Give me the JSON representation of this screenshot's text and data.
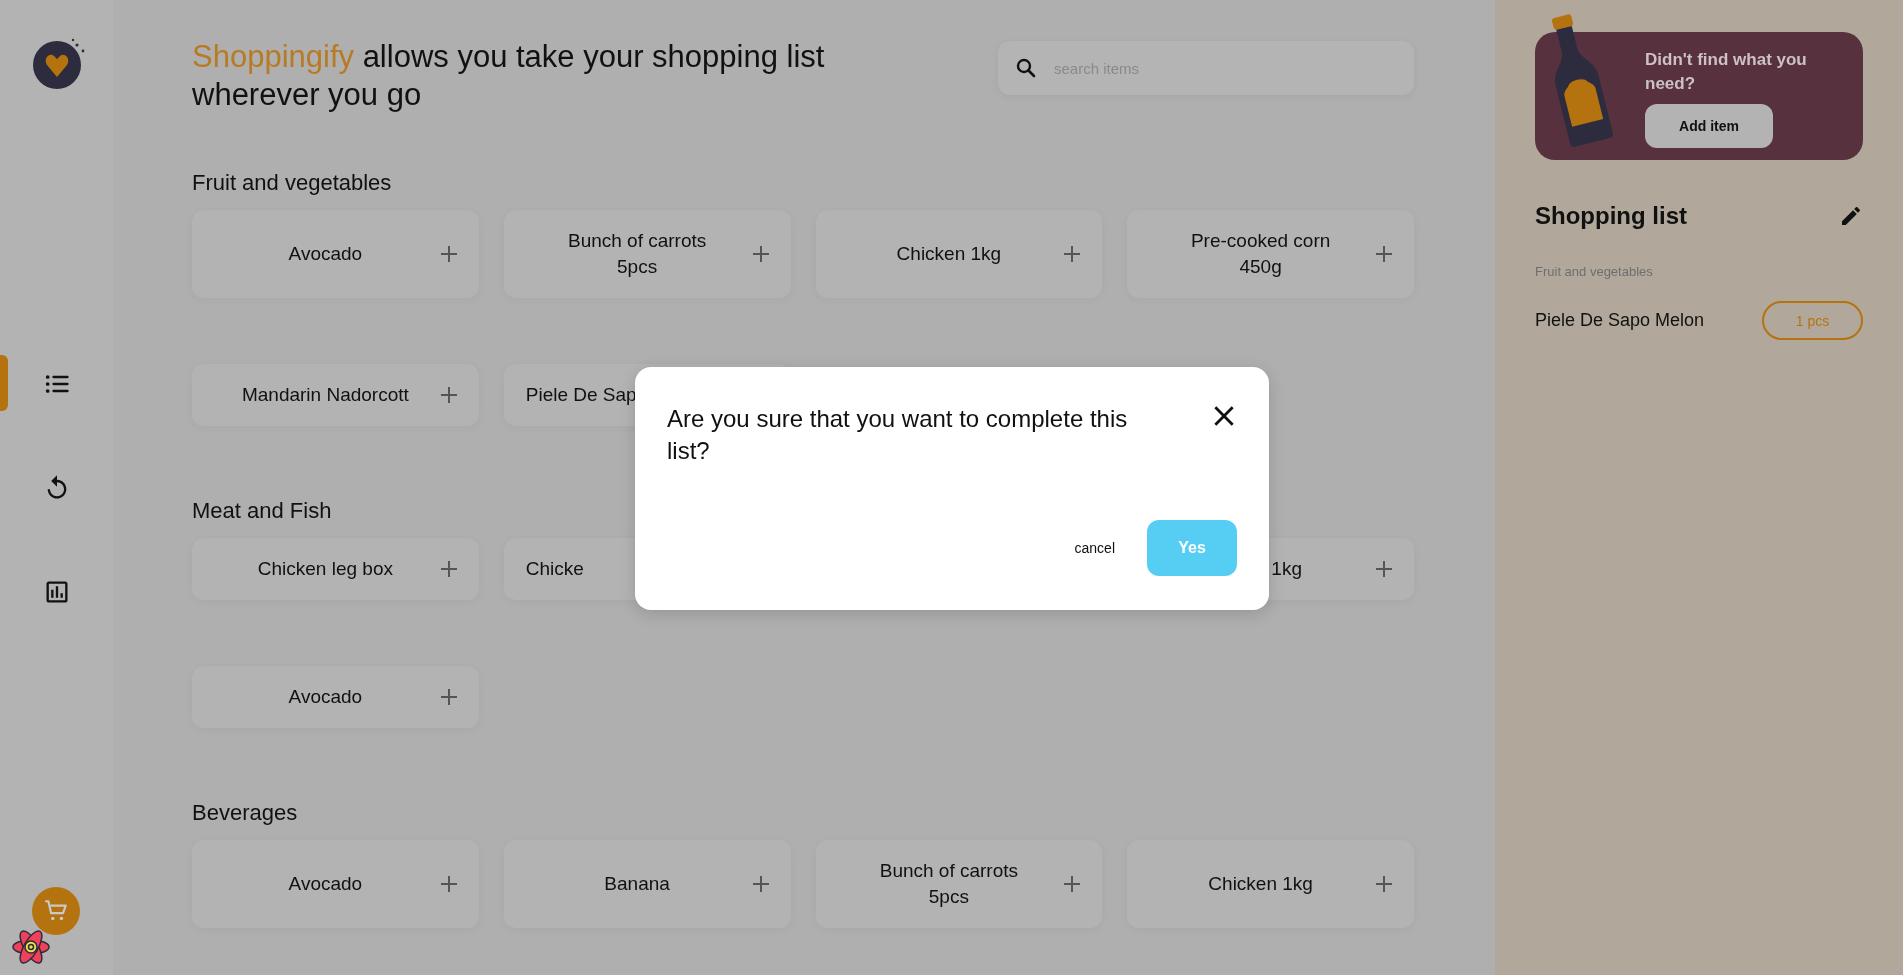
{
  "sidebar": {
    "nav": [
      {
        "kind": "list",
        "selected": true
      },
      {
        "kind": "history",
        "selected": false
      },
      {
        "kind": "stats",
        "selected": false
      }
    ]
  },
  "header": {
    "brand": "Shoppingify",
    "tagline": "allows you take your shopping list wherever you go"
  },
  "search": {
    "placeholder": "search items"
  },
  "categories": [
    {
      "name": "Fruit and vegetables",
      "items": [
        {
          "kind": "card",
          "label": "Avocado"
        },
        {
          "kind": "card",
          "label": "Bunch of carrots 5pcs"
        },
        {
          "kind": "card",
          "label": "Chicken 1kg"
        },
        {
          "kind": "card",
          "label": "Pre-cooked corn 450g"
        },
        {
          "kind": "card",
          "label": "Mandarin Nadorcott"
        },
        {
          "kind": "leftpart",
          "label": "Piele De Sap"
        }
      ]
    },
    {
      "name": "Meat and Fish",
      "items": [
        {
          "kind": "card",
          "label": "Chicken leg box"
        },
        {
          "kind": "leftpart",
          "label": "Chicke"
        },
        {
          "kind": "covered"
        },
        {
          "kind": "rightpart",
          "label": "1kg"
        },
        {
          "kind": "card",
          "label": "Avocado"
        }
      ]
    },
    {
      "name": "Beverages",
      "items": [
        {
          "kind": "card",
          "label": "Avocado"
        },
        {
          "kind": "card",
          "label": "Banana"
        },
        {
          "kind": "card",
          "label": "Bunch of carrots 5pcs"
        },
        {
          "kind": "card",
          "label": "Chicken 1kg"
        }
      ]
    }
  ],
  "modal": {
    "question": "Are you sure that you want to complete this list?",
    "cancel": "cancel",
    "confirm": "Yes"
  },
  "banner": {
    "text": "Didn't find what you need?",
    "button": "Add item"
  },
  "shopping_list": {
    "title": "Shopping list",
    "categories": [
      {
        "name": "Fruit and vegetables",
        "items": [
          {
            "name": "Piele De Sapo Melon",
            "quantity": "1 pcs"
          }
        ]
      }
    ]
  }
}
